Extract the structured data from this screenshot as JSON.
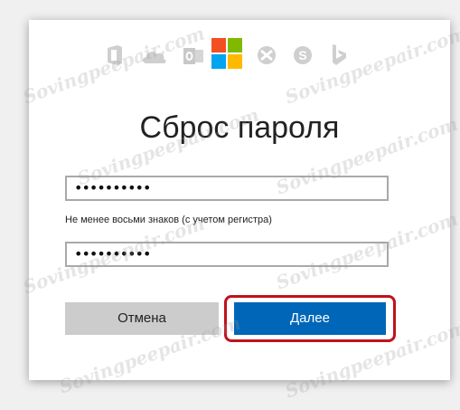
{
  "app": {
    "icons": [
      "office-icon",
      "onedrive-icon",
      "outlook-icon",
      "microsoft-logo-icon",
      "xbox-icon",
      "skype-icon",
      "bing-icon"
    ]
  },
  "page": {
    "title": "Сброс пароля"
  },
  "form": {
    "password": {
      "value": "••••••••••"
    },
    "hint": "Не менее восьми знаков (с учетом регистра)",
    "confirm_password": {
      "value": "••••••••••"
    }
  },
  "buttons": {
    "cancel": "Отмена",
    "next": "Далее"
  },
  "watermark": "Sovingpeepair.com",
  "colors": {
    "primary": "#0067b8",
    "highlight": "#c0121c",
    "ms_red": "#f25022",
    "ms_green": "#7fba00",
    "ms_blue": "#00a4ef",
    "ms_yellow": "#ffb900"
  }
}
